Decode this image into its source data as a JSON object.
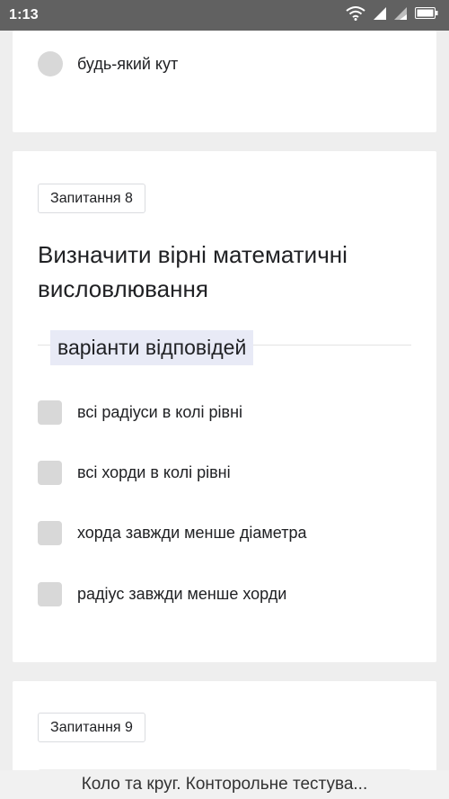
{
  "status_bar": {
    "time": "1:13",
    "icons": [
      "wifi-icon",
      "signal-icon",
      "signal-icon",
      "battery-icon"
    ]
  },
  "prev_question": {
    "option_label": "будь-який кут"
  },
  "question8": {
    "badge": "Запитання 8",
    "title": "Визначити вірні математичні висловлювання",
    "section_label": "варіанти відповідей",
    "options": [
      "всі радіуси в колі рівні",
      "всі хорди в колі рівні",
      "хорда завжди менше діаметра",
      "радіус завжди менше хорди"
    ]
  },
  "question9": {
    "badge": "Запитання 9"
  },
  "banner": {
    "text": "Коло та круг. Конторольне тестува..."
  },
  "colors": {
    "status_bar": "#616161",
    "background": "#eeeeee",
    "chip": "#e8eaf6",
    "control": "#d8d8d8"
  }
}
